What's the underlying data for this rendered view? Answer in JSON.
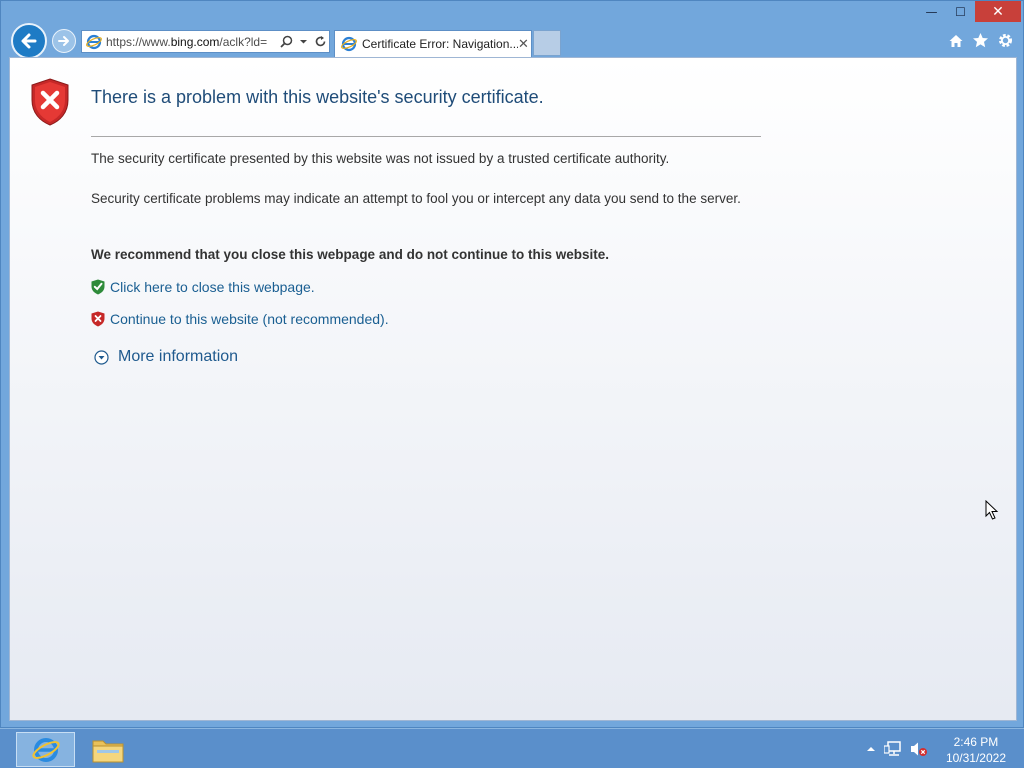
{
  "browser": {
    "address": {
      "url_prefix": "https://www.",
      "url_domain": "bing.com",
      "url_suffix": "/aclk?ld="
    },
    "tab": {
      "title": "Certificate Error: Navigation...",
      "close": "✕"
    },
    "window_controls": {
      "minimize": "—",
      "maximize": "☐",
      "close": "✕"
    }
  },
  "page": {
    "heading": "There is a problem with this website's security certificate.",
    "paragraph1": "The security certificate presented by this website was not issued by a trusted certificate authority.",
    "paragraph2": "Security certificate problems may indicate an attempt to fool you or intercept any data you send to the server.",
    "recommendation": "We recommend that you close this webpage and do not continue to this website.",
    "close_link": "Click here to close this webpage.",
    "continue_link": "Continue to this website (not recommended).",
    "more_info": "More information"
  },
  "taskbar": {
    "time": "2:46 PM",
    "date": "10/31/2022"
  },
  "colors": {
    "accent": "#1e7bc5",
    "link": "#1a5f92",
    "heading": "#1f4c78",
    "close_button": "#c8403a"
  }
}
